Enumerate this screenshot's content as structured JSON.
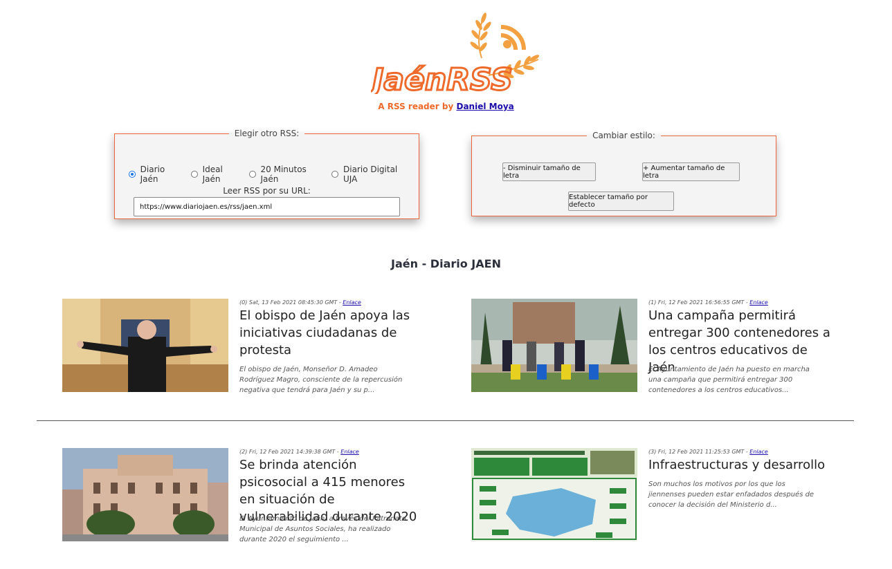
{
  "header": {
    "logo_text": "JaénRSS",
    "byline_prefix": "A RSS reader by",
    "author_link": "Daniel Moya",
    "brand_color": "#ef6a2a"
  },
  "rss_selector": {
    "legend": "Elegir otro RSS:",
    "options": [
      {
        "label": "Diario Jaén",
        "checked": true
      },
      {
        "label": "Ideal Jaén",
        "checked": false
      },
      {
        "label": "20 Minutos Jaén",
        "checked": false
      },
      {
        "label": "Diario Digital UJA",
        "checked": false
      }
    ],
    "url_label": "Leer RSS por su URL:",
    "url_value": "https://www.diariojaen.es/rss/jaen.xml"
  },
  "style_panel": {
    "legend": "Cambiar estilo:",
    "decrease_label": "- Disminuir tamaño de letra",
    "increase_label": "+ Aumentar tamaño de letra",
    "default_label": "Establecer tamaño por defecto"
  },
  "feed": {
    "title": "Jaén - Diario JAEN",
    "link_label": "Enlace",
    "articles": [
      {
        "meta": "(0) Sat, 13 Feb 2021 08:45:30 GMT -",
        "title": "El obispo de Jaén apoya las iniciativas ciudadanas de protesta",
        "summary": "El obispo de Jaén, Monseñor D. Amadeo Rodríguez Magro, consciente de la repercusión negativa que tendrá para Jaén y su p...",
        "image": "bishop-photo"
      },
      {
        "meta": "(1) Fri, 12 Feb 2021 16:56:55 GMT -",
        "title": "Una campaña permitirá entregar 300 contenedores a los centros educativos de Jaén",
        "summary": "El Ayuntamiento de Jaén ha puesto en marcha una campaña que permitirá entregar 300 contenedores a los centros educativos...",
        "image": "containers-photo"
      },
      {
        "meta": "(2) Fri, 12 Feb 2021 14:39:38 GMT -",
        "title": "Se brinda atención psicosocial a 415 menores en situación de vulnerabilidad durante 2020",
        "summary": "El Ayuntamiento de Jaén, a través del Patronato Municipal de Asuntos Sociales, ha realizado durante 2020 el seguimiento ...",
        "image": "town-hall-photo"
      },
      {
        "meta": "(3) Fri, 12 Feb 2021 11:25:53 GMT -",
        "title": "Infraestructuras y desarrollo",
        "summary": "Son muchos los motivos por los que los jiennenses pueden estar enfadados después de conocer la decisión del Ministerio d...",
        "image": "infographic-map"
      }
    ]
  }
}
